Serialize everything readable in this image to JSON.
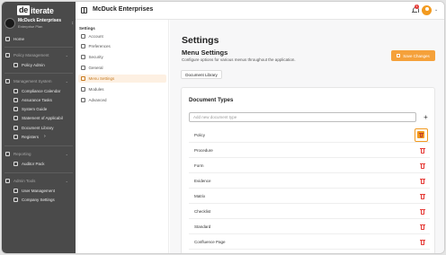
{
  "sidebar": {
    "logo_prefix": "de",
    "logo_rest": "iterate",
    "org_name": "McDuck Enterprises",
    "org_plan": "Enterprise Plan",
    "items": [
      {
        "label": "Home"
      },
      {
        "label": "Policy Management"
      },
      {
        "label": "Policy Admin"
      },
      {
        "label": "Management System"
      },
      {
        "label": "Compliance Calendar"
      },
      {
        "label": "Assurance Tasks"
      },
      {
        "label": "System Guide"
      },
      {
        "label": "Statement of Applicabil"
      },
      {
        "label": "Document Library"
      },
      {
        "label": "Registers"
      },
      {
        "label": "Reporting"
      },
      {
        "label": "Auditor Pack"
      },
      {
        "label": "Admin Tools"
      },
      {
        "label": "User Management"
      },
      {
        "label": "Company Settings"
      }
    ]
  },
  "topbar": {
    "title": "McDuck Enterprises",
    "notification_count": "1"
  },
  "settings_nav": {
    "header": "Settings",
    "items": [
      {
        "label": "Account"
      },
      {
        "label": "Preferences"
      },
      {
        "label": "Security"
      },
      {
        "label": "General"
      },
      {
        "label": "Menu Settings"
      },
      {
        "label": "Modules"
      },
      {
        "label": "Advanced"
      }
    ]
  },
  "main": {
    "title": "Settings",
    "subtitle": "Menu Settings",
    "description": "Configure options for various menus throughout the application.",
    "save_label": "Save Changes",
    "tab_label": "Document Library",
    "card_title": "Document Types",
    "add_placeholder": "Add new document type",
    "add_button": "+",
    "types": [
      {
        "label": "Policy"
      },
      {
        "label": "Procedure"
      },
      {
        "label": "Form"
      },
      {
        "label": "Evidence"
      },
      {
        "label": "Matrix"
      },
      {
        "label": "Checklist"
      },
      {
        "label": "Standard"
      },
      {
        "label": "Confluence Page"
      }
    ]
  },
  "colors": {
    "accent": "#f5a13a",
    "sidebar_bg": "#4a4a4a",
    "delete": "#e53935"
  }
}
